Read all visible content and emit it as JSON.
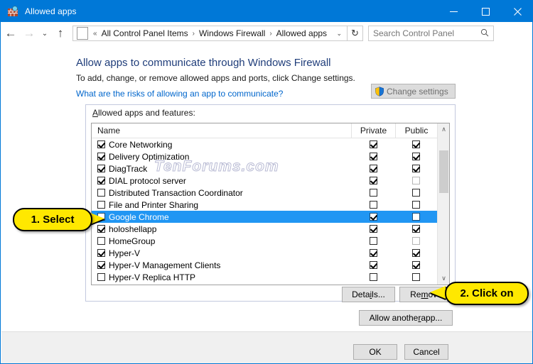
{
  "window": {
    "title": "Allowed apps",
    "icon": "firewall-icon",
    "minimize_label": "–",
    "maximize_label": "☐",
    "close_label": "✕"
  },
  "navbar": {
    "back_label": "←",
    "forward_label": "→",
    "recent_label": "⌄",
    "up_label": "↑",
    "breadcrumb_prefix": "«",
    "breadcrumbs": [
      "All Control Panel Items",
      "Windows Firewall",
      "Allowed apps"
    ],
    "breadcrumb_separator": "›",
    "dropdown_label": "⌄",
    "refresh_label": "↻",
    "search_placeholder": "Search Control Panel",
    "search_value": "",
    "search_icon_label": "⚲"
  },
  "page": {
    "heading": "Allow apps to communicate through Windows Firewall",
    "subtitle": "To add, change, or remove allowed apps and ports, click Change settings.",
    "risk_link": "What are the risks of allowing an app to communicate?",
    "change_settings_label": "Change settings",
    "change_settings_enabled": false,
    "watermark": "TenForums.com"
  },
  "groupbox": {
    "label_first": "A",
    "label_rest": "llowed apps and features:"
  },
  "list": {
    "columns": [
      "Name",
      "Private",
      "Public"
    ],
    "scroll_up_label": "∧",
    "scroll_down_label": "∨",
    "rows": [
      {
        "name": "Core Networking",
        "name_checked": true,
        "private": "checked",
        "public": "checked",
        "selected": false
      },
      {
        "name": "Delivery Optimization",
        "name_checked": true,
        "private": "checked",
        "public": "checked",
        "selected": false
      },
      {
        "name": "DiagTrack",
        "name_checked": true,
        "private": "checked",
        "public": "checked",
        "selected": false
      },
      {
        "name": "DIAL protocol server",
        "name_checked": true,
        "private": "checked",
        "public": "unchecked-dim",
        "selected": false
      },
      {
        "name": "Distributed Transaction Coordinator",
        "name_checked": false,
        "private": "unchecked",
        "public": "unchecked",
        "selected": false
      },
      {
        "name": "File and Printer Sharing",
        "name_checked": false,
        "private": "unchecked",
        "public": "unchecked",
        "selected": false
      },
      {
        "name": "Google Chrome",
        "name_checked": false,
        "private": "checked",
        "public": "unchecked",
        "selected": true
      },
      {
        "name": "holoshellapp",
        "name_checked": true,
        "private": "checked",
        "public": "checked",
        "selected": false
      },
      {
        "name": "HomeGroup",
        "name_checked": false,
        "private": "unchecked",
        "public": "unchecked-dim",
        "selected": false
      },
      {
        "name": "Hyper-V",
        "name_checked": true,
        "private": "checked",
        "public": "checked",
        "selected": false
      },
      {
        "name": "Hyper-V Management Clients",
        "name_checked": true,
        "private": "checked",
        "public": "checked",
        "selected": false
      },
      {
        "name": "Hyper-V Replica HTTP",
        "name_checked": false,
        "private": "unchecked",
        "public": "unchecked",
        "selected": false
      }
    ]
  },
  "buttons": {
    "details_pre": "Deta",
    "details_accel": "i",
    "details_post": "ls...",
    "remove_pre": "Re",
    "remove_accel": "m",
    "remove_post": "ove",
    "allow_pre": "Allow anothe",
    "allow_accel": "r",
    "allow_post": " app...",
    "ok": "OK",
    "cancel": "Cancel"
  },
  "callouts": {
    "one": "1. Select",
    "two": "2. Click on"
  },
  "colors": {
    "accent": "#0078d7",
    "selection": "#2196f3",
    "heading": "#1f3d7a",
    "link": "#0066cc",
    "callout": "#ffe800"
  }
}
